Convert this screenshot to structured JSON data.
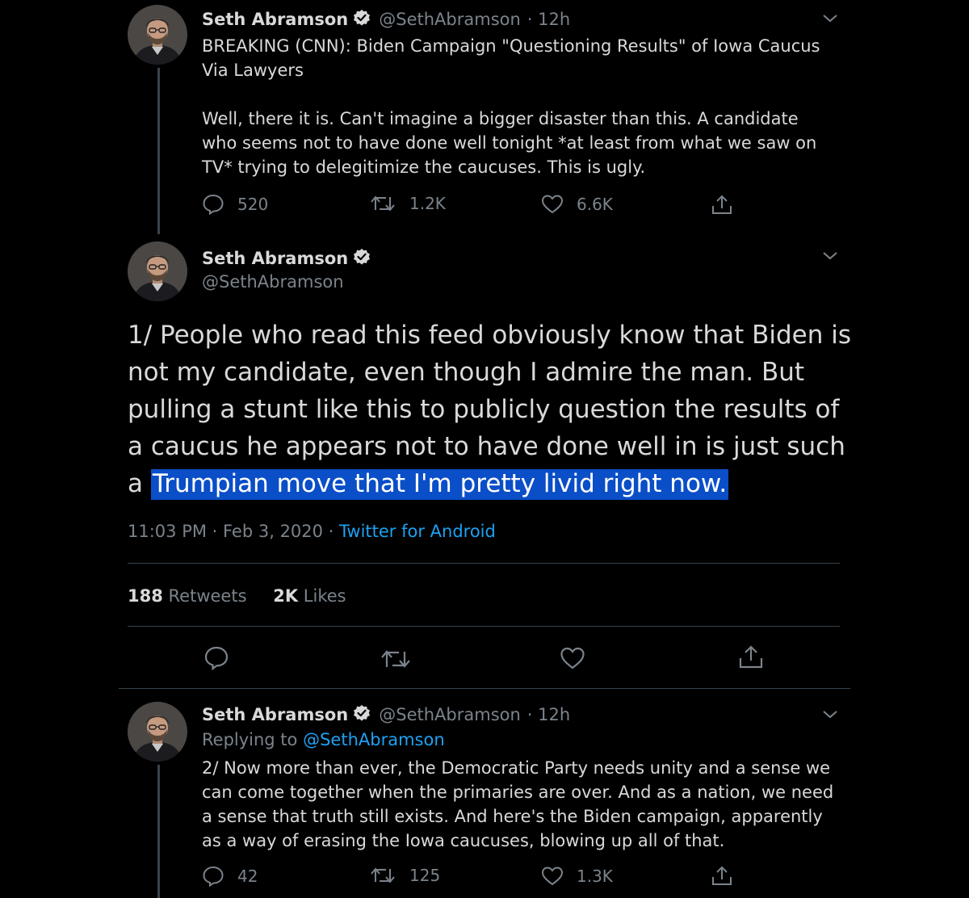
{
  "colors": {
    "background": "#000000",
    "text": "#d9d9d9",
    "muted": "#7b838b",
    "link": "#1da1f2",
    "divider": "#38444d",
    "highlight": "#0a4ec8"
  },
  "tweet1": {
    "name": "Seth Abramson",
    "handle": "@SethAbramson",
    "time": "· 12h",
    "text_line1": "BREAKING (CNN): Biden Campaign \"Questioning Results\" of Iowa Caucus Via Lawyers",
    "text_line2": "Well, there it is. Can't imagine a bigger disaster than this. A candidate who seems not to have done well tonight *at least from what we saw on TV* trying to delegitimize the caucuses. This is ugly.",
    "replies": "520",
    "retweets": "1.2K",
    "likes": "6.6K"
  },
  "main_tweet": {
    "name": "Seth Abramson",
    "handle": "@SethAbramson",
    "text_plain": "1/ People who read this feed obviously know that Biden is not my candidate, even though I admire the man. But pulling a stunt like this to publicly question the results of a caucus he appears not to have done well in is just such a ",
    "text_highlighted": "Trumpian move that I'm pretty livid right now.",
    "timestamp": "11:03 PM · Feb 3, 2020 · ",
    "source": "Twitter for Android",
    "retweet_count": "188",
    "retweet_label": "Retweets",
    "like_count": "2K",
    "like_label": "Likes"
  },
  "tweet3": {
    "name": "Seth Abramson",
    "handle": "@SethAbramson",
    "time": "· 12h",
    "replying_label": "Replying to",
    "replying_handle": "@SethAbramson",
    "text": "2/ Now more than ever, the Democratic Party needs unity and a sense we can come together when the primaries are over. And as a nation, we need a sense that truth still exists. And here's the Biden campaign, apparently as a way of erasing the Iowa caucuses, blowing up all of that.",
    "replies": "42",
    "retweets": "125",
    "likes": "1.3K"
  },
  "icons": {
    "reply": "reply-icon",
    "retweet": "retweet-icon",
    "like": "heart-icon",
    "share": "share-icon",
    "verified": "verified-badge-icon",
    "menu": "chevron-down-icon"
  }
}
